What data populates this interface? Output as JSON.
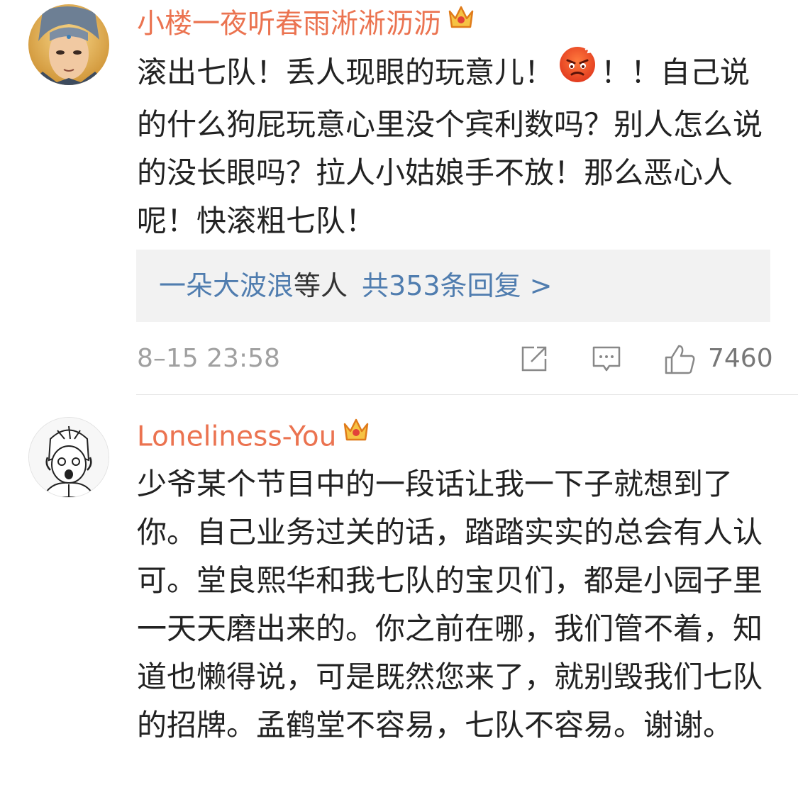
{
  "comments": [
    {
      "username": "小楼一夜听春雨淅淅沥沥",
      "text_before_emoji": "滚出七队！丢人现眼的玩意儿！",
      "emoji": "angry-face-icon",
      "text_after_emoji": "！！自己说的什么狗屁玩意心里没个宾利数吗？别人怎么说的没长眼吗？拉人小姑娘手不放！那么恶心人呢！快滚粗七队！",
      "replies": {
        "names": "一朵大波浪",
        "suffix": "等人",
        "count_label": "共353条回复 >"
      },
      "timestamp": "8–15 23:58",
      "likes": "7460",
      "badge": "crown-badge-icon"
    },
    {
      "username": "Loneliness-You",
      "text": "少爷某个节目中的一段话让我一下子就想到了你。自己业务过关的话，踏踏实实的总会有人认可。堂良熙华和我七队的宝贝们，都是小园子里一天天磨出来的。你之前在哪，我们管不着，知道也懒得说，可是既然您来了，就别毁我们七队的招牌。孟鹤堂不容易，七队不容易。谢谢。",
      "badge": "crown-badge-icon"
    }
  ],
  "colors": {
    "username": "#eb7350",
    "link": "#507daf",
    "meta": "#a0a0a0",
    "reply_bg": "#f2f2f2"
  }
}
